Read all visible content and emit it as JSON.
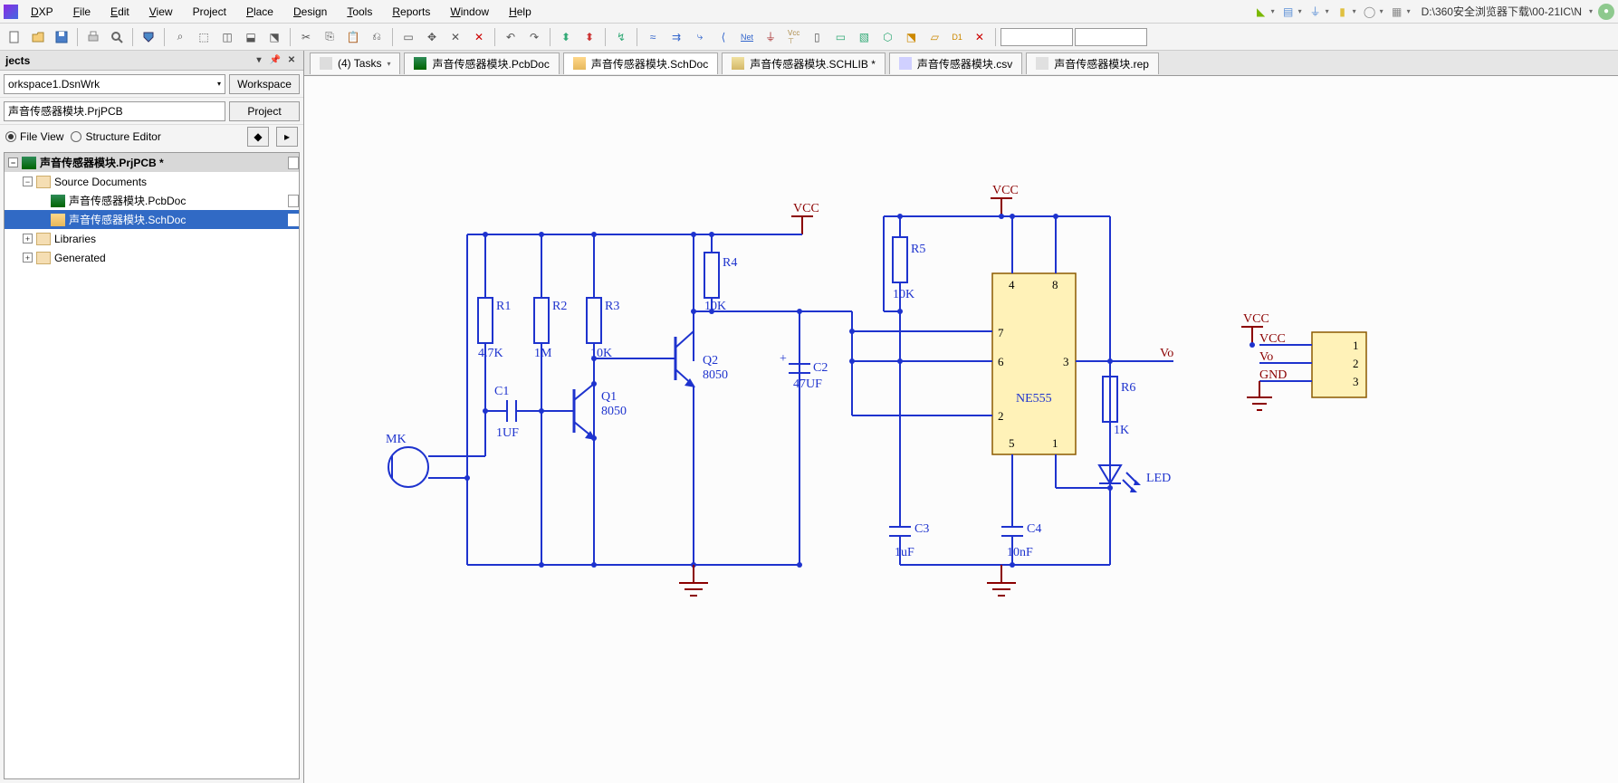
{
  "menus": {
    "dxp": "DXP",
    "file": "File",
    "edit": "Edit",
    "view": "View",
    "project": "Project",
    "place": "Place",
    "design": "Design",
    "tools": "Tools",
    "reports": "Reports",
    "window": "Window",
    "help": "Help"
  },
  "path": "D:\\360安全浏览器下载\\00-21IC\\N",
  "panel": {
    "title": "jects",
    "workspace": "orkspace1.DsnWrk",
    "workspace_btn": "Workspace",
    "project": "声音传感器模块.PrjPCB",
    "project_btn": "Project",
    "fileview": "File View",
    "structview": "Structure Editor"
  },
  "tree": {
    "project": "声音传感器模块.PrjPCB *",
    "src": "Source Documents",
    "pcb": "声音传感器模块.PcbDoc",
    "sch": "声音传感器模块.SchDoc",
    "libs": "Libraries",
    "gen": "Generated"
  },
  "tabs": {
    "tasks": "(4) Tasks",
    "pcb": "声音传感器模块.PcbDoc",
    "sch": "声音传感器模块.SchDoc",
    "schlib": "声音传感器模块.SCHLIB *",
    "csv": "声音传感器模块.csv",
    "rep": "声音传感器模块.rep"
  },
  "sch": {
    "mk": "MK",
    "r1": "R1",
    "r1v": "4.7K",
    "r2": "R2",
    "r2v": "1M",
    "r3": "R3",
    "r3v": "10K",
    "r4": "R4",
    "r4v": "10K",
    "r5": "R5",
    "r5v": "10K",
    "r6": "R6",
    "r6v": "1K",
    "c1": "C1",
    "c1v": "1UF",
    "c2": "C2",
    "c2v": "47UF",
    "c3": "C3",
    "c3v": "1uF",
    "c4": "C4",
    "c4v": "10nF",
    "q1": "Q1",
    "q1v": "8050",
    "q2": "Q2",
    "q2v": "8050",
    "ic": "NE555",
    "led": "LED",
    "vcc": "VCC",
    "vo": "Vo",
    "gnd": "GND",
    "p1": "1",
    "p2": "2",
    "p3": "3",
    "p4": "4",
    "p5": "5",
    "p6": "6",
    "p7": "7",
    "p8": "8"
  }
}
